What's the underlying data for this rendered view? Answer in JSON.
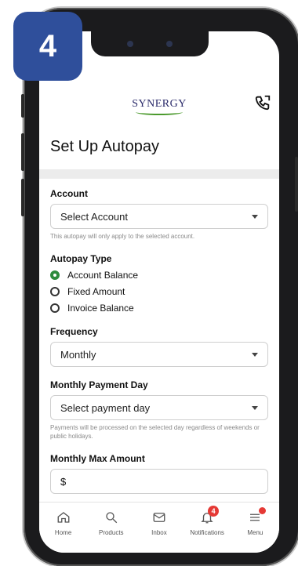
{
  "step": "4",
  "header": {
    "logo_text": "SYNERGY"
  },
  "page_title": "Set Up Autopay",
  "account": {
    "label": "Account",
    "value": "Select Account",
    "hint": "This autopay will only apply to the selected account."
  },
  "autopay_type": {
    "label": "Autopay Type",
    "options": [
      "Account Balance",
      "Fixed Amount",
      "Invoice Balance"
    ],
    "selected": "Account Balance"
  },
  "frequency": {
    "label": "Frequency",
    "value": "Monthly"
  },
  "payment_day": {
    "label": "Monthly Payment Day",
    "value": "Select payment day",
    "hint": "Payments will be processed on the selected day regardless of weekends or public holidays."
  },
  "max_amount": {
    "label": "Monthly Max Amount",
    "value": "$"
  },
  "nav": {
    "home": "Home",
    "products": "Products",
    "inbox": "Inbox",
    "notifications": "Notifications",
    "notifications_badge": "4",
    "menu": "Menu"
  },
  "colors": {
    "brand_blue": "#2f4f9b",
    "selected_green": "#2e8b3d",
    "badge_red": "#e53935"
  }
}
